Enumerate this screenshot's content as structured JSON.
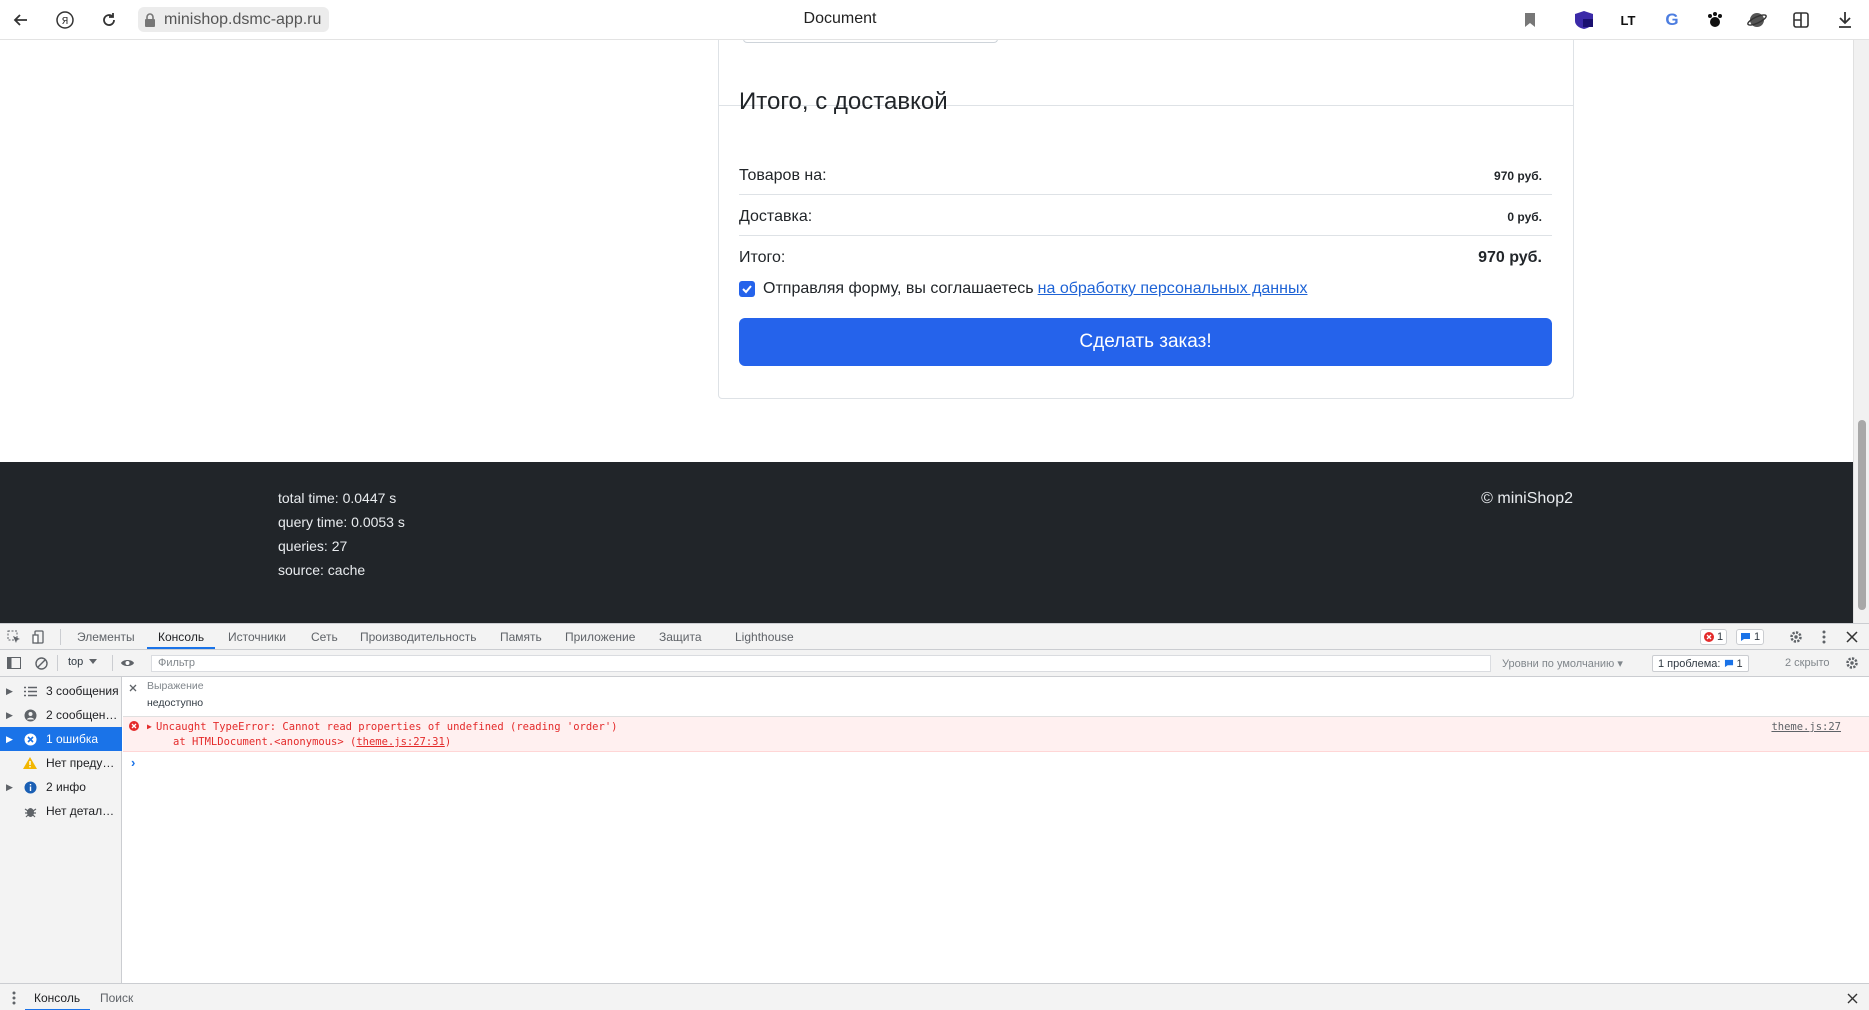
{
  "browser": {
    "url": "minishop.dsmc-app.ru",
    "tab_title": "Document",
    "ext_lt_label": "LT",
    "ext_g_label": "G"
  },
  "summary": {
    "title": "Итого, с доставкой",
    "rows": [
      {
        "label": "Товаров на:",
        "value": "970 руб."
      },
      {
        "label": "Доставка:",
        "value": "0 руб."
      },
      {
        "label": "Итого:",
        "value": "970 руб."
      }
    ],
    "agree_text": "Отправляя форму, вы соглашаетесь",
    "agree_link": "на обработку персональных данных",
    "agree_checked": true,
    "submit_label": "Сделать заказ!"
  },
  "footer": {
    "stats": [
      "total time: 0.0447 s",
      "query time: 0.0053 s",
      "queries: 27",
      "source: cache"
    ],
    "copyright": "© miniShop2"
  },
  "devtools": {
    "tabs": [
      "Элементы",
      "Консоль",
      "Источники",
      "Сеть",
      "Производительность",
      "Память",
      "Приложение",
      "Защита",
      "Lighthouse"
    ],
    "active_tab": "Консоль",
    "error_count": "1",
    "message_count": "1",
    "context": "top",
    "filter_placeholder": "Фильтр",
    "levels": "Уровни по умолчанию ▾",
    "issues_label": "1 проблема:",
    "issues_count": "1",
    "hidden": "2 скрыто",
    "sidebar": [
      {
        "label": "3 сообщения",
        "icon": "list-icon"
      },
      {
        "label": "2 сообщен…",
        "icon": "user-icon"
      },
      {
        "label": "1 ошибка",
        "icon": "error-icon"
      },
      {
        "label": "Нет преду…",
        "icon": "warning-icon"
      },
      {
        "label": "2 инфо",
        "icon": "info-icon"
      },
      {
        "label": "Нет детал…",
        "icon": "bug-icon"
      }
    ],
    "expression_label": "Выражение",
    "expression_value": "недоступно",
    "error_line1": "Uncaught TypeError: Cannot read properties of undefined (reading 'order')",
    "error_line2_prefix": "at HTMLDocument.<anonymous> (",
    "error_line2_link": "theme.js:27:31",
    "error_line2_suffix": ")",
    "error_source": "theme.js:27",
    "drawer_tabs": [
      "Консоль",
      "Поиск"
    ],
    "colors": {
      "accent": "#1a73e8",
      "error": "#e42b2b",
      "primary_button": "#2563eb",
      "footer": "#212529"
    }
  }
}
